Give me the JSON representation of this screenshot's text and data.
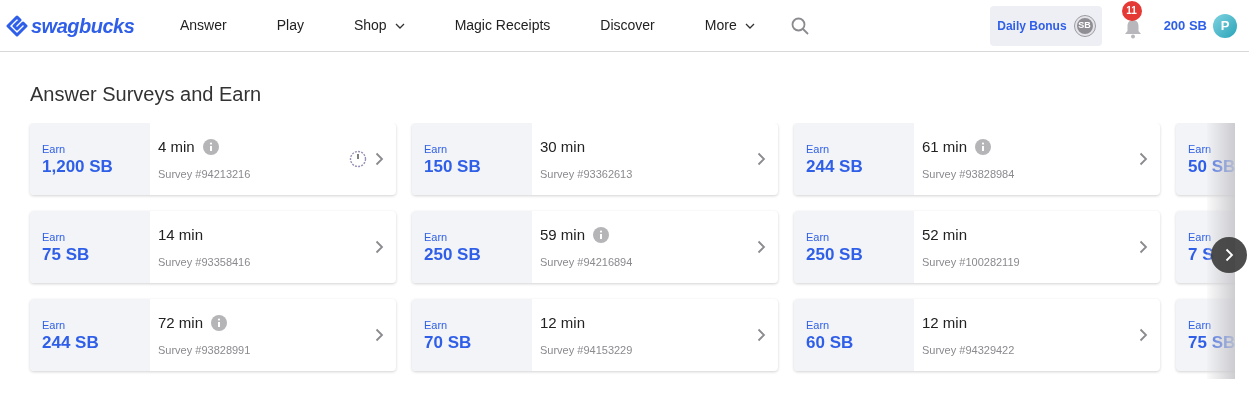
{
  "header": {
    "logo": "swagbucks",
    "nav": [
      {
        "label": "Answer",
        "dropdown": false
      },
      {
        "label": "Play",
        "dropdown": false
      },
      {
        "label": "Shop",
        "dropdown": true
      },
      {
        "label": "Magic Receipts",
        "dropdown": false
      },
      {
        "label": "Discover",
        "dropdown": false
      },
      {
        "label": "More",
        "dropdown": true
      }
    ],
    "daily_bonus": {
      "label": "Daily Bonus",
      "coin": "SB"
    },
    "notifications": "11",
    "balance": "200 SB",
    "avatar": "P"
  },
  "section_title": "Answer Surveys and Earn",
  "rows": [
    [
      {
        "kind": "full",
        "earn": "Earn",
        "amount": "1,200 SB",
        "time": "4 min",
        "info": true,
        "timer": true,
        "survey": "Survey #94213216"
      },
      {
        "kind": "full",
        "earn": "Earn",
        "amount": "150 SB",
        "time": "30 min",
        "info": false,
        "timer": false,
        "survey": "Survey #93362613"
      },
      {
        "kind": "full",
        "earn": "Earn",
        "amount": "244 SB",
        "time": "61 min",
        "info": true,
        "timer": false,
        "survey": "Survey #93828984"
      },
      {
        "kind": "cut",
        "earn": "Earn",
        "amount": "50 SB"
      }
    ],
    [
      {
        "kind": "full",
        "earn": "Earn",
        "amount": "75 SB",
        "time": "14 min",
        "info": false,
        "timer": false,
        "survey": "Survey #93358416"
      },
      {
        "kind": "full",
        "earn": "Earn",
        "amount": "250 SB",
        "time": "59 min",
        "info": true,
        "timer": false,
        "survey": "Survey #94216894"
      },
      {
        "kind": "full",
        "earn": "Earn",
        "amount": "250 SB",
        "time": "52 min",
        "info": false,
        "timer": false,
        "survey": "Survey #100282119"
      },
      {
        "kind": "cut",
        "earn": "Earn",
        "amount": "7 S"
      }
    ],
    [
      {
        "kind": "full",
        "earn": "Earn",
        "amount": "244 SB",
        "time": "72 min",
        "info": true,
        "timer": false,
        "survey": "Survey #93828991"
      },
      {
        "kind": "full",
        "earn": "Earn",
        "amount": "70 SB",
        "time": "12 min",
        "info": false,
        "timer": false,
        "survey": "Survey #94153229"
      },
      {
        "kind": "full",
        "earn": "Earn",
        "amount": "60 SB",
        "time": "12 min",
        "info": false,
        "timer": false,
        "survey": "Survey #94329422"
      },
      {
        "kind": "cut",
        "earn": "Earn",
        "amount": "75 SB"
      }
    ]
  ]
}
